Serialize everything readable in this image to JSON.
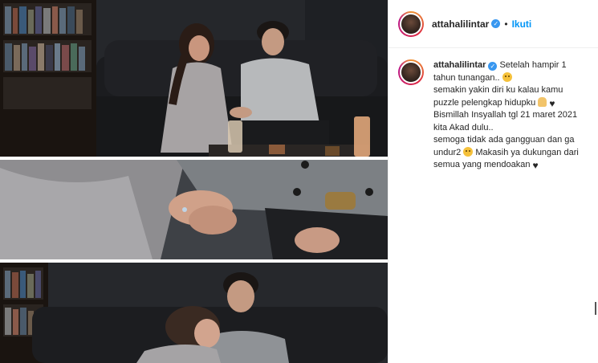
{
  "post": {
    "username": "attahalilintar",
    "verified": true,
    "dot": "•",
    "follow_label": "Ikuti",
    "caption": {
      "line1": "Setelah hampir 1",
      "line2": "tahun tunangan..",
      "line3": "semakin yakin diri ku kalau kamu",
      "line4": "puzzle pelengkap hidupku",
      "line5": "Bismillah Insyallah tgl 21 maret 2021",
      "line6": "kita Akad dulu..",
      "line7": "semoga tidak ada gangguan dan ga",
      "line8": "undur2",
      "line8b": "Makasih ya dukungan dari",
      "line9": "semua yang mendoakan"
    }
  },
  "icons": {
    "verified": "verified-badge-icon",
    "emoji_smile": "smiling-face-emoji",
    "emoji_pray": "folded-hands-emoji",
    "emoji_heart": "black-heart-emoji"
  },
  "colors": {
    "link_blue": "#0095f6",
    "verified_blue": "#3897f0",
    "text": "#262626"
  }
}
